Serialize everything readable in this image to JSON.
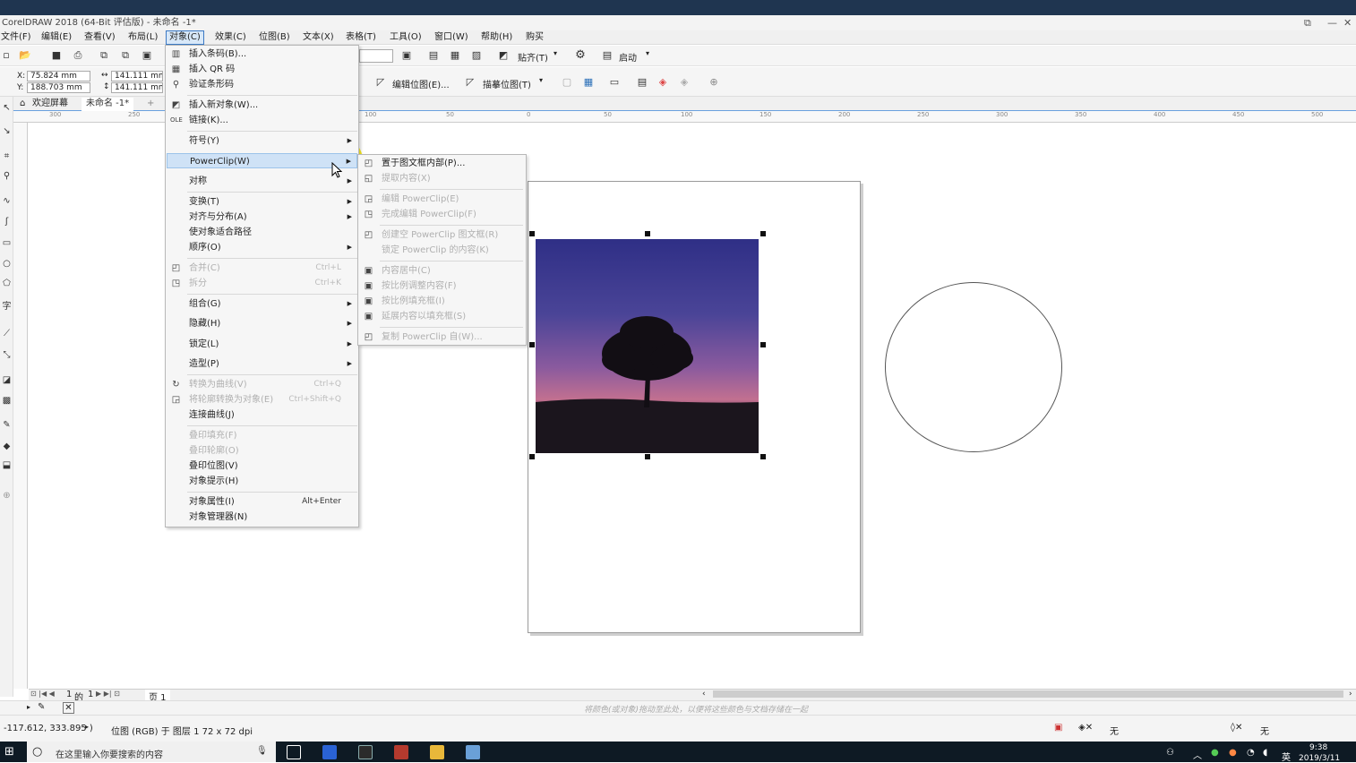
{
  "window": {
    "title": "CorelDRAW 2018 (64-Bit 评估版) - 未命名 -1*",
    "controls": [
      "⧉",
      "—",
      "✕"
    ]
  },
  "menubar": [
    "文件(F)",
    "编辑(E)",
    "查看(V)",
    "布局(L)",
    "对象(C)",
    "效果(C)",
    "位图(B)",
    "文本(X)",
    "表格(T)",
    "工具(O)",
    "窗口(W)",
    "帮助(H)",
    "购买"
  ],
  "toolbar1": {
    "snap_label": "贴齐(T)",
    "launch_label": "启动"
  },
  "propbar": {
    "x": "75.824 mm",
    "y": "188.703 mm",
    "w": "141.111 mm",
    "h": "141.111 mm",
    "x_label": "X:",
    "y_label": "Y:",
    "edit_bitmap": "编辑位图(E)...",
    "trace_bitmap": "描摹位图(T)"
  },
  "tabs": {
    "welcome": "欢迎屏幕",
    "doc": "未命名 -1*",
    "add": "+"
  },
  "ruler_ticks": [
    "300",
    "250",
    "100",
    "50",
    "0",
    "50",
    "100",
    "150",
    "200",
    "250",
    "300",
    "350",
    "400",
    "450",
    "500"
  ],
  "object_menu": [
    {
      "label": "插入条码(B)...",
      "icon": "barcode-icon"
    },
    {
      "label": "插入 QR 码",
      "icon": "qr-icon"
    },
    {
      "label": "验证条形码",
      "icon": "verify-icon"
    },
    {
      "label": "插入新对象(W)...",
      "icon": "insert-object-icon"
    },
    {
      "label": "链接(K)...",
      "icon": "ole-icon"
    },
    {
      "label": "符号(Y)"
    },
    {
      "label": "PowerClip(W)"
    },
    {
      "label": "对称"
    },
    {
      "label": "变换(T)"
    },
    {
      "label": "对齐与分布(A)"
    },
    {
      "label": "使对象适合路径"
    },
    {
      "label": "顺序(O)"
    },
    {
      "label": "合并(C)",
      "accel": "Ctrl+L"
    },
    {
      "label": "拆分",
      "accel": "Ctrl+K"
    },
    {
      "label": "组合(G)"
    },
    {
      "label": "隐藏(H)"
    },
    {
      "label": "锁定(L)"
    },
    {
      "label": "造型(P)"
    },
    {
      "label": "转换为曲线(V)",
      "accel": "Ctrl+Q"
    },
    {
      "label": "将轮廓转换为对象(E)",
      "accel": "Ctrl+Shift+Q"
    },
    {
      "label": "连接曲线(J)"
    },
    {
      "label": "叠印填充(F)"
    },
    {
      "label": "叠印轮廓(O)"
    },
    {
      "label": "叠印位图(V)"
    },
    {
      "label": "对象提示(H)"
    },
    {
      "label": "对象属性(I)",
      "accel": "Alt+Enter"
    },
    {
      "label": "对象管理器(N)"
    }
  ],
  "powerclip_menu": [
    {
      "label": "置于图文框内部(P)...",
      "enabled": true
    },
    {
      "label": "提取内容(X)",
      "enabled": false
    },
    {
      "label": "编辑 PowerClip(E)",
      "enabled": false
    },
    {
      "label": "完成编辑 PowerClip(F)",
      "enabled": false
    },
    {
      "label": "创建空 PowerClip 图文框(R)",
      "enabled": false
    },
    {
      "label": "锁定 PowerClip 的内容(K)",
      "enabled": false
    },
    {
      "label": "内容居中(C)",
      "enabled": false
    },
    {
      "label": "按比例调整内容(F)",
      "enabled": false
    },
    {
      "label": "按比例填充框(I)",
      "enabled": false
    },
    {
      "label": "延展内容以填充框(S)",
      "enabled": false
    },
    {
      "label": "复制 PowerClip 自(W)...",
      "enabled": false
    }
  ],
  "pagenav": {
    "current": "1",
    "of": "的",
    "total": "1",
    "page_tab": "页 1"
  },
  "colorbar_hint": "将颜色(或对象)拖动至此处，以便将这些颜色与文档存储在一起",
  "status": {
    "coords": "-117.612, 333.895 )",
    "info": "位图 (RGB) 于 图层 1 72 x 72 dpi",
    "fill_none": "无",
    "outline_none": "无"
  },
  "taskbar": {
    "search_placeholder": "在这里输入你要搜索的内容",
    "time": "9:38",
    "date": "2019/3/11",
    "ime": "英"
  }
}
